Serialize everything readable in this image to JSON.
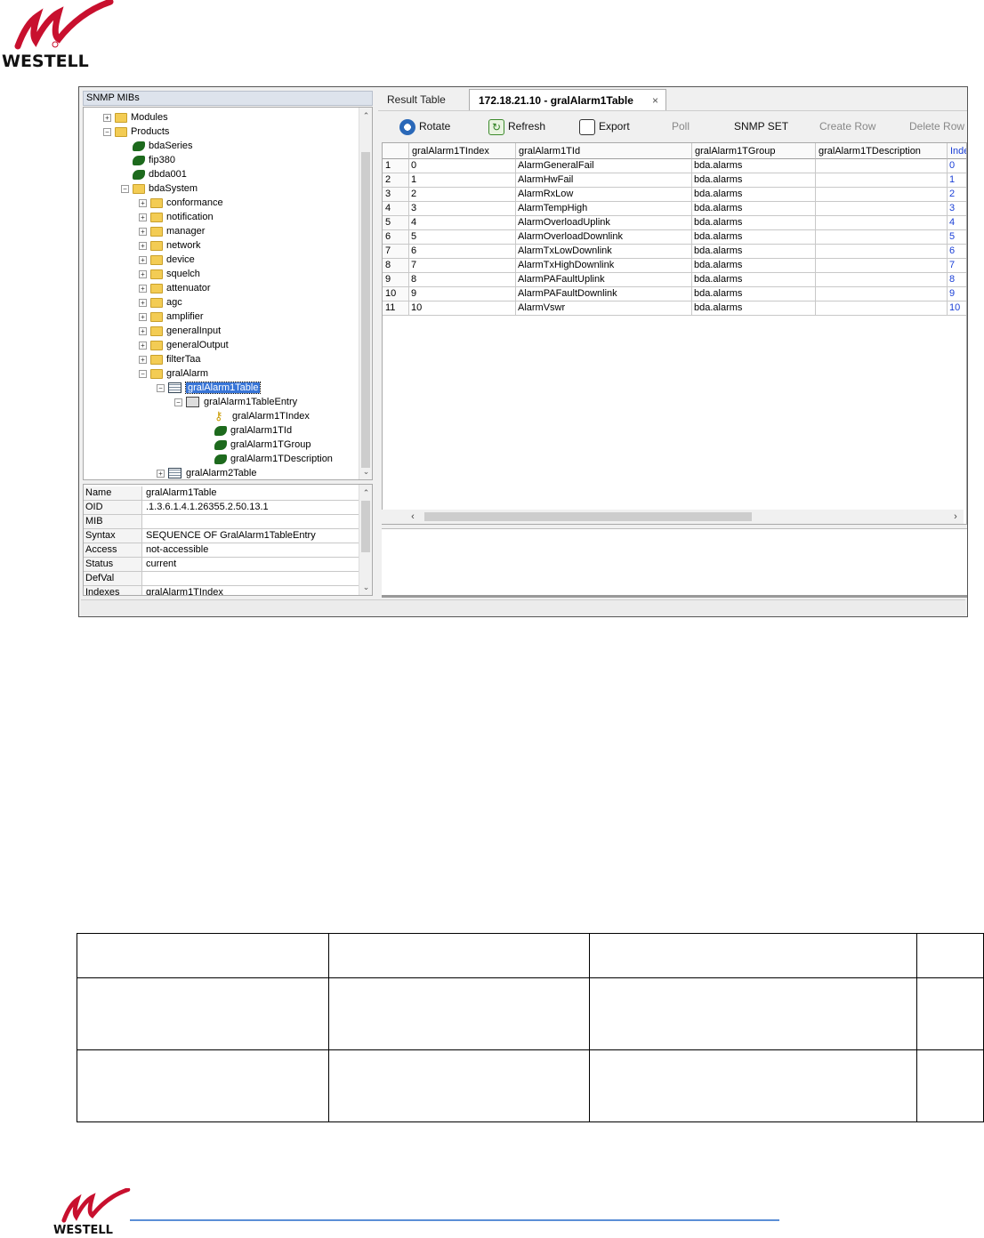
{
  "brand": {
    "name": "WESTELL",
    "accent": "#c8102e"
  },
  "left_pane": {
    "title": "SNMP MIBs",
    "tree": [
      {
        "label": "Modules",
        "icon": "folder-icon",
        "depth": 1,
        "expander": "+"
      },
      {
        "label": "Products",
        "icon": "folder-icon",
        "depth": 1,
        "expander": "-"
      },
      {
        "label": "bdaSeries",
        "icon": "leaf-icon",
        "depth": 2,
        "expander": ""
      },
      {
        "label": "fip380",
        "icon": "leaf-icon",
        "depth": 2,
        "expander": ""
      },
      {
        "label": "dbda001",
        "icon": "leaf-icon",
        "depth": 2,
        "expander": ""
      },
      {
        "label": "bdaSystem",
        "icon": "folder-icon",
        "depth": 2,
        "expander": "-"
      },
      {
        "label": "conformance",
        "icon": "folder-icon",
        "depth": 3,
        "expander": "+"
      },
      {
        "label": "notification",
        "icon": "folder-icon",
        "depth": 3,
        "expander": "+"
      },
      {
        "label": "manager",
        "icon": "folder-icon",
        "depth": 3,
        "expander": "+"
      },
      {
        "label": "network",
        "icon": "folder-icon",
        "depth": 3,
        "expander": "+"
      },
      {
        "label": "device",
        "icon": "folder-icon",
        "depth": 3,
        "expander": "+"
      },
      {
        "label": "squelch",
        "icon": "folder-icon",
        "depth": 3,
        "expander": "+"
      },
      {
        "label": "attenuator",
        "icon": "folder-icon",
        "depth": 3,
        "expander": "+"
      },
      {
        "label": "agc",
        "icon": "folder-icon",
        "depth": 3,
        "expander": "+"
      },
      {
        "label": "amplifier",
        "icon": "folder-icon",
        "depth": 3,
        "expander": "+"
      },
      {
        "label": "generalInput",
        "icon": "folder-icon",
        "depth": 3,
        "expander": "+"
      },
      {
        "label": "generalOutput",
        "icon": "folder-icon",
        "depth": 3,
        "expander": "+"
      },
      {
        "label": "filterTaa",
        "icon": "folder-icon",
        "depth": 3,
        "expander": "+"
      },
      {
        "label": "gralAlarm",
        "icon": "folder-icon",
        "depth": 3,
        "expander": "-"
      },
      {
        "label": "gralAlarm1Table",
        "icon": "table-icon",
        "depth": 4,
        "expander": "-",
        "selected": true
      },
      {
        "label": "gralAlarm1TableEntry",
        "icon": "entry-icon",
        "depth": 5,
        "expander": "-"
      },
      {
        "label": "gralAlarm1TIndex",
        "icon": "key-icon",
        "depth": 6,
        "expander": ""
      },
      {
        "label": "gralAlarm1TId",
        "icon": "leaf-icon",
        "depth": 6,
        "expander": ""
      },
      {
        "label": "gralAlarm1TGroup",
        "icon": "leaf-icon",
        "depth": 6,
        "expander": ""
      },
      {
        "label": "gralAlarm1TDescription",
        "icon": "leaf-icon",
        "depth": 6,
        "expander": ""
      },
      {
        "label": "gralAlarm2Table",
        "icon": "table-icon",
        "depth": 4,
        "expander": "+"
      }
    ],
    "properties": [
      {
        "key": "Name",
        "value": "gralAlarm1Table"
      },
      {
        "key": "OID",
        "value": ".1.3.6.1.4.1.26355.2.50.13.1"
      },
      {
        "key": "MIB",
        "value": ""
      },
      {
        "key": "Syntax",
        "value": "SEQUENCE OF GralAlarm1TableEntry"
      },
      {
        "key": "Access",
        "value": "not-accessible"
      },
      {
        "key": "Status",
        "value": "current"
      },
      {
        "key": "DefVal",
        "value": ""
      },
      {
        "key": "Indexes",
        "value": "gralAlarm1TIndex"
      }
    ]
  },
  "right_pane": {
    "tabs": {
      "result_label": "Result Table",
      "active_label": "172.18.21.10 - gralAlarm1Table",
      "close_symbol": "×"
    },
    "toolbar": {
      "rotate": "Rotate",
      "refresh": "Refresh",
      "export": "Export",
      "poll": "Poll",
      "snmp_set": "SNMP SET",
      "create_row": "Create Row",
      "delete_row": "Delete Row"
    },
    "grid": {
      "columns": [
        "gralAlarm1TIndex",
        "gralAlarm1TId",
        "gralAlarm1TGroup",
        "gralAlarm1TDescription",
        "Inde"
      ],
      "rows": [
        {
          "num": "1",
          "index": "0",
          "id": "AlarmGeneralFail",
          "group": "bda.alarms",
          "desc": "",
          "inde": "0"
        },
        {
          "num": "2",
          "index": "1",
          "id": "AlarmHwFail",
          "group": "bda.alarms",
          "desc": "",
          "inde": "1"
        },
        {
          "num": "3",
          "index": "2",
          "id": "AlarmRxLow",
          "group": "bda.alarms",
          "desc": "",
          "inde": "2"
        },
        {
          "num": "4",
          "index": "3",
          "id": "AlarmTempHigh",
          "group": "bda.alarms",
          "desc": "",
          "inde": "3"
        },
        {
          "num": "5",
          "index": "4",
          "id": "AlarmOverloadUplink",
          "group": "bda.alarms",
          "desc": "",
          "inde": "4"
        },
        {
          "num": "6",
          "index": "5",
          "id": "AlarmOverloadDownlink",
          "group": "bda.alarms",
          "desc": "",
          "inde": "5"
        },
        {
          "num": "7",
          "index": "6",
          "id": "AlarmTxLowDownlink",
          "group": "bda.alarms",
          "desc": "",
          "inde": "6"
        },
        {
          "num": "8",
          "index": "7",
          "id": "AlarmTxHighDownlink",
          "group": "bda.alarms",
          "desc": "",
          "inde": "7"
        },
        {
          "num": "9",
          "index": "8",
          "id": "AlarmPAFaultUplink",
          "group": "bda.alarms",
          "desc": "",
          "inde": "8"
        },
        {
          "num": "10",
          "index": "9",
          "id": "AlarmPAFaultDownlink",
          "group": "bda.alarms",
          "desc": "",
          "inde": "9"
        },
        {
          "num": "11",
          "index": "10",
          "id": "AlarmVswr",
          "group": "bda.alarms",
          "desc": "",
          "inde": "10"
        }
      ]
    }
  }
}
